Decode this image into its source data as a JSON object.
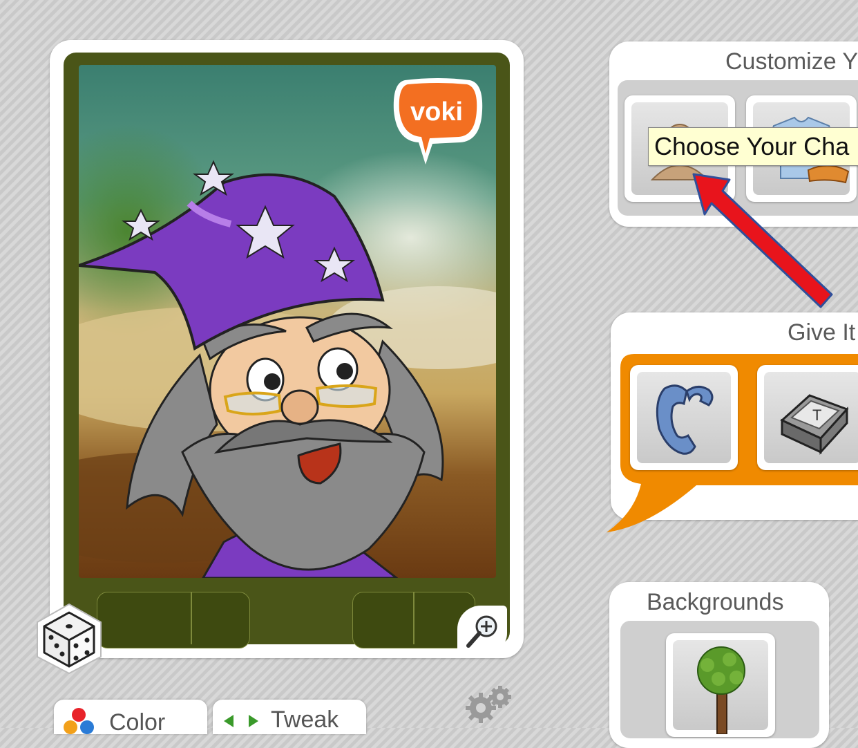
{
  "stage": {
    "logo_text": "voki",
    "logo_color": "#f36f21"
  },
  "bottom_tabs": {
    "color_label": "Color",
    "tweak_label": "Tweak"
  },
  "customize_panel": {
    "title": "Customize Y",
    "tiles": [
      "head-icon",
      "clothing-icon"
    ]
  },
  "tooltip": {
    "text": "Choose Your Cha"
  },
  "voice_panel": {
    "title": "Give It",
    "accent": "#f08a00",
    "tiles": [
      "phone-icon",
      "keyboard-key-icon"
    ]
  },
  "backgrounds_panel": {
    "title": "Backgrounds",
    "tiles": [
      "tree-icon"
    ]
  },
  "annotation": {
    "arrow_color": "#e8141c"
  }
}
